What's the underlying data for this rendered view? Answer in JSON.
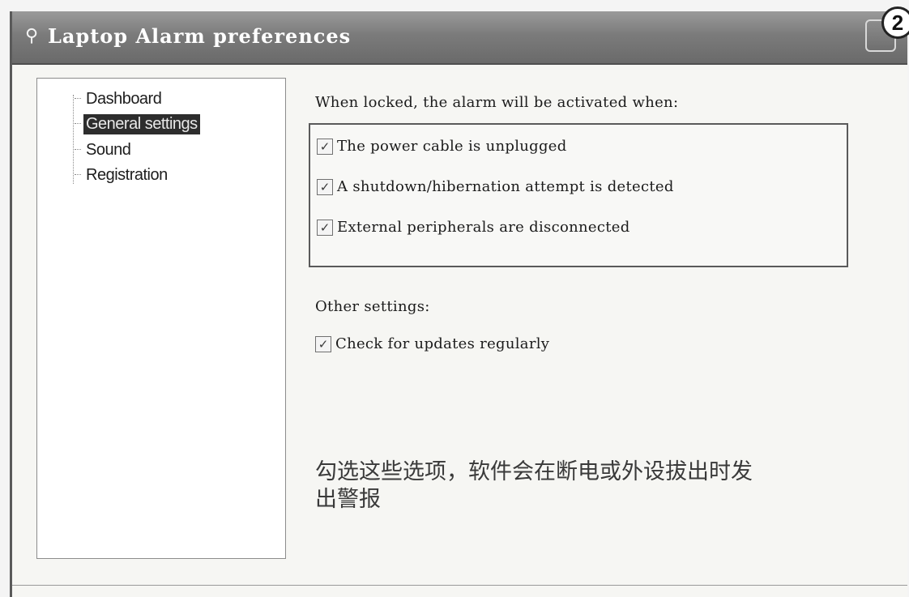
{
  "window": {
    "title": "Laptop Alarm preferences",
    "title_icon": "laptop-alarm-icon",
    "step_number": "2"
  },
  "tree": {
    "items": [
      {
        "label": "Dashboard",
        "selected": false
      },
      {
        "label": "General settings",
        "selected": true
      },
      {
        "label": "Sound",
        "selected": false
      },
      {
        "label": "Registration",
        "selected": false
      }
    ]
  },
  "general": {
    "heading": "When locked, the alarm will be activated when:",
    "options": [
      {
        "label": "The power cable is unplugged",
        "checked": true
      },
      {
        "label": "A shutdown/hibernation attempt is detected",
        "checked": true
      },
      {
        "label": "External peripherals are disconnected",
        "checked": true
      }
    ]
  },
  "other": {
    "heading": "Other settings:",
    "options": [
      {
        "label": "Check for updates regularly",
        "checked": true
      }
    ]
  },
  "annotation": "勾选这些选项，软件会在断电或外设拔出时发出警报",
  "colors": {
    "titlebar": "#7b7b7b",
    "selection": "#2d2d2d",
    "panel_bg": "#ffffff"
  }
}
